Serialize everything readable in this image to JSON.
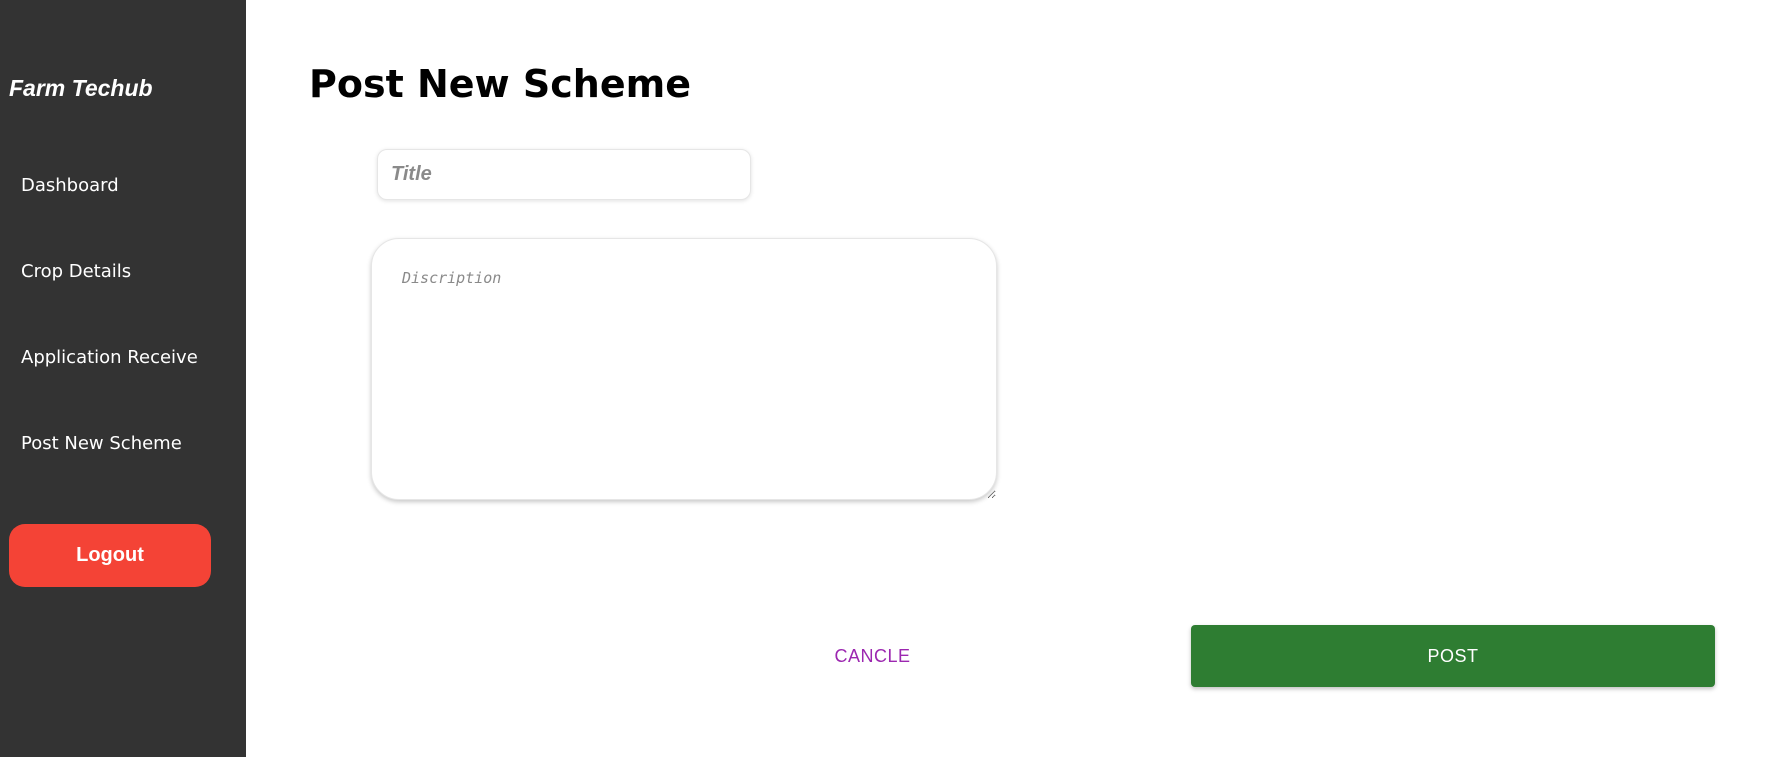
{
  "sidebar": {
    "brand": "Farm Techub",
    "items": [
      {
        "label": "Dashboard"
      },
      {
        "label": "Crop Details"
      },
      {
        "label": "Application Receive"
      },
      {
        "label": "Post New Scheme"
      }
    ],
    "logout_label": "Logout"
  },
  "main": {
    "title": "Post New Scheme",
    "form": {
      "title_placeholder": "Title",
      "title_value": "",
      "description_placeholder": "Discription",
      "description_value": ""
    },
    "actions": {
      "cancel_label": "CANCLE",
      "post_label": "POST"
    }
  },
  "colors": {
    "sidebar_bg": "#333333",
    "logout_bg": "#f44336",
    "post_bg": "#2e7d32",
    "cancel_text": "#9c27b0"
  }
}
